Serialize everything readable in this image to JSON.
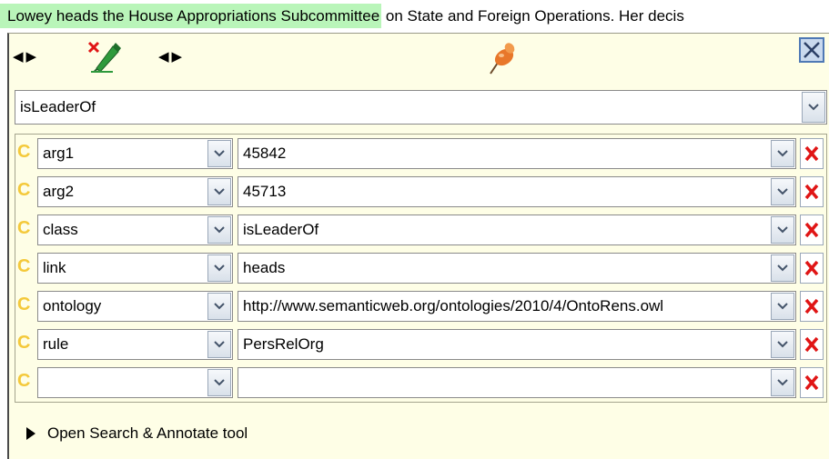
{
  "document_text": {
    "highlighted": "Lowey heads the House Appropriations Subcommittee",
    "rest": " on State and Foreign Operations. Her decis"
  },
  "editor": {
    "type_value": "isLeaderOf",
    "features": [
      {
        "mark": "C",
        "name": "arg1",
        "value": "45842"
      },
      {
        "mark": "C",
        "name": "arg2",
        "value": "45713"
      },
      {
        "mark": "C",
        "name": "class",
        "value": "isLeaderOf"
      },
      {
        "mark": "C",
        "name": "link",
        "value": "heads"
      },
      {
        "mark": "C",
        "name": "ontology",
        "value": "http://www.semanticweb.org/ontologies/2010/4/OntoRens.owl"
      },
      {
        "mark": "C",
        "name": "rule",
        "value": "PersRelOrg"
      },
      {
        "mark": "C",
        "name": "",
        "value": ""
      }
    ],
    "open_search_label": "Open Search & Annotate tool"
  },
  "icons": {
    "nav_arrows": "left-right-arrows-icon",
    "delete_annotation": "pencil-delete-icon",
    "pin": "pushpin-icon",
    "close": "close-icon",
    "dropdown": "chevron-down-icon",
    "remove_feature": "red-x-icon",
    "expand": "triangle-right-icon"
  },
  "colors": {
    "highlight": "#b9f5b9",
    "panel_bg": "#fefee6",
    "c_mark": "#f4c93a",
    "remove_x": "#e01515",
    "pencil": "#2e9a3c",
    "pin": "#e8772a"
  }
}
